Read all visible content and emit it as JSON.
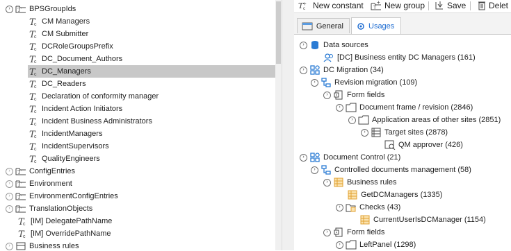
{
  "left_tree": {
    "group_title": "BPSGroupIds",
    "children": [
      "CM Managers",
      "CM Submitter",
      "DCRoleGroupsPrefix",
      "DC_Document_Authors",
      "DC_Managers",
      "DC_Readers",
      "Declaration of conformity manager",
      "Incident Action Initiators",
      "Incident Business Administrators",
      "IncidentManagers",
      "IncidentSupervisors",
      "QualityEngineers"
    ],
    "selected": "DC_Managers",
    "siblings": [
      "ConfigEntries",
      "Environment",
      "EnvironmentConfigEntries",
      "TranslationObjects"
    ],
    "im_items": [
      "[IM] DelegatePathName",
      "[IM] OverridePathName"
    ],
    "partial_bottom": "Business rules"
  },
  "toolbar": {
    "new_constant": "New constant",
    "new_group": "New group",
    "save": "Save",
    "delete": "Delet"
  },
  "tabs": {
    "general": "General",
    "usages": "Usages"
  },
  "usages": {
    "data_sources": "Data sources",
    "business_entity": "[DC] Business entity DC Managers (161)",
    "dc_migration": "DC Migration (34)",
    "revision_migration": "Revision migration (109)",
    "form_fields_1": "Form fields",
    "document_frame": "Document frame / revision (2846)",
    "application_areas": "Application areas of other sites (2851)",
    "target_sites": "Target sites (2878)",
    "qm_approver": "QM approver (426)",
    "document_control": "Document Control (21)",
    "controlled_docs": "Controlled documents management (58)",
    "business_rules": "Business rules",
    "get_dc_managers": "GetDCManagers (1335)",
    "checks": "Checks (43)",
    "current_user": "CurrentUserIsDCManager (1154)",
    "form_fields_2": "Form fields",
    "left_panel": "LeftPanel (1298)"
  },
  "colors": {
    "accent": "#1c6bd1",
    "selection": "#c8c8c8",
    "icon_blue": "#2a7bd4",
    "icon_orange": "#e0a030"
  }
}
